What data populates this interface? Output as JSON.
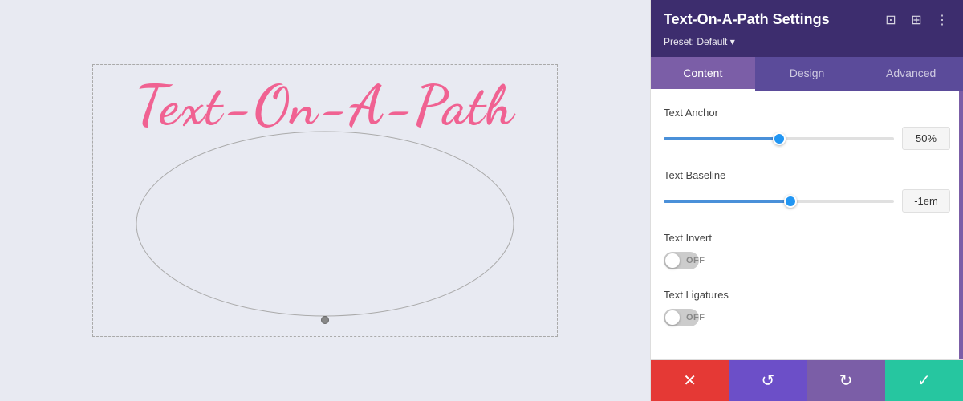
{
  "panel": {
    "title": "Text-On-A-Path Settings",
    "preset_label": "Preset: Default",
    "preset_arrow": "▾"
  },
  "tabs": [
    {
      "id": "content",
      "label": "Content",
      "active": true
    },
    {
      "id": "design",
      "label": "Design",
      "active": false
    },
    {
      "id": "advanced",
      "label": "Advanced",
      "active": false
    }
  ],
  "settings": {
    "text_anchor": {
      "label": "Text Anchor",
      "value": "50%",
      "percent": 50
    },
    "text_baseline": {
      "label": "Text Baseline",
      "value": "-1em",
      "percent": 55
    },
    "text_invert": {
      "label": "Text Invert",
      "toggle_off_label": "OFF",
      "enabled": false
    },
    "text_ligatures": {
      "label": "Text Ligatures",
      "toggle_off_label": "OFF",
      "enabled": false
    }
  },
  "canvas": {
    "text": "Text-On-A-Path"
  },
  "toolbar": {
    "cancel_icon": "✕",
    "reset_icon": "↺",
    "redo_icon": "↻",
    "confirm_icon": "✓"
  },
  "header_icons": {
    "expand": "⊡",
    "split": "⊞",
    "more": "⋮"
  }
}
